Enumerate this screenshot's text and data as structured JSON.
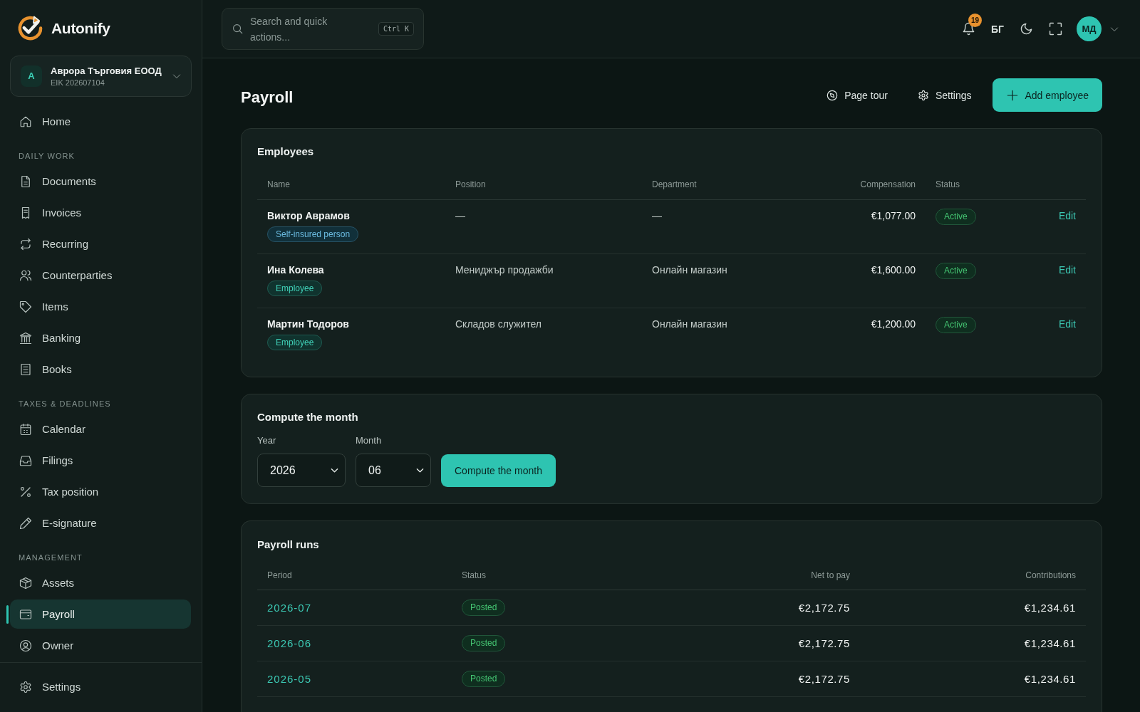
{
  "sidebar": {
    "brand": "Autonify",
    "org": {
      "initial": "A",
      "name": "Аврора Търговия ЕООД",
      "eik": "EIK 202607104"
    },
    "sections": [
      {
        "items": [
          {
            "label": "Home",
            "selected": false
          }
        ]
      },
      {
        "heading": "DAILY WORK",
        "items": [
          {
            "label": "Documents",
            "selected": false
          },
          {
            "label": "Invoices",
            "selected": false
          },
          {
            "label": "Recurring",
            "selected": false
          },
          {
            "label": "Counterparties",
            "selected": false
          },
          {
            "label": "Items",
            "selected": false
          },
          {
            "label": "Banking",
            "selected": false
          },
          {
            "label": "Books",
            "selected": false
          }
        ]
      },
      {
        "heading": "TAXES & DEADLINES",
        "items": [
          {
            "label": "Calendar",
            "selected": false
          },
          {
            "label": "Filings",
            "selected": false
          },
          {
            "label": "Tax position",
            "selected": false
          },
          {
            "label": "E-signature",
            "selected": false
          }
        ]
      },
      {
        "heading": "MANAGEMENT",
        "items": [
          {
            "label": "Assets",
            "selected": false
          },
          {
            "label": "Payroll",
            "selected": true
          },
          {
            "label": "Owner",
            "selected": false
          }
        ]
      }
    ],
    "footer": {
      "label": "Settings",
      "selected": false
    }
  },
  "topbar": {
    "search": {
      "placeholder": "Search and quick actions...",
      "shortcut": "Ctrl K"
    },
    "notifications": "19",
    "language": "БГ",
    "avatar": "МД"
  },
  "page": {
    "title": "Payroll",
    "actions": [
      {
        "label": "Page tour",
        "kind": "ghost"
      },
      {
        "label": "Settings",
        "kind": "ghost"
      },
      {
        "label": "Add employee",
        "kind": "primary"
      }
    ]
  },
  "employees": {
    "title": "Employees",
    "columns": [
      "Name",
      "Position",
      "Department",
      "Compensation",
      "Status"
    ],
    "rows": [
      {
        "name": "Виктор Аврамов",
        "tag": {
          "label": "Self-insured person",
          "kind": "insured"
        },
        "position": "—",
        "department": "—",
        "compensation": "€1,077.00",
        "status": "Active",
        "action": "Edit"
      },
      {
        "name": "Ина Колева",
        "tag": {
          "label": "Employee",
          "kind": "employee"
        },
        "position": "Мениджър продажби",
        "department": "Онлайн магазин",
        "compensation": "€1,600.00",
        "status": "Active",
        "action": "Edit"
      },
      {
        "name": "Мартин Тодоров",
        "tag": {
          "label": "Employee",
          "kind": "employee"
        },
        "position": "Складов служител",
        "department": "Онлайн магазин",
        "compensation": "€1,200.00",
        "status": "Active",
        "action": "Edit"
      }
    ]
  },
  "compute": {
    "title": "Compute the month",
    "fields": [
      {
        "label": "Year",
        "value": "2026"
      },
      {
        "label": "Month",
        "value": "06"
      }
    ],
    "button": "Compute the month"
  },
  "runs": {
    "title": "Payroll runs",
    "columns": [
      "Period",
      "Status",
      "Net to pay",
      "Contributions"
    ],
    "rows": [
      {
        "period": "2026-07",
        "status": "Posted",
        "net": "€2,172.75",
        "contributions": "€1,234.61"
      },
      {
        "period": "2026-06",
        "status": "Posted",
        "net": "€2,172.75",
        "contributions": "€1,234.61"
      },
      {
        "period": "2026-05",
        "status": "Posted",
        "net": "€2,172.75",
        "contributions": "€1,234.61"
      }
    ]
  }
}
